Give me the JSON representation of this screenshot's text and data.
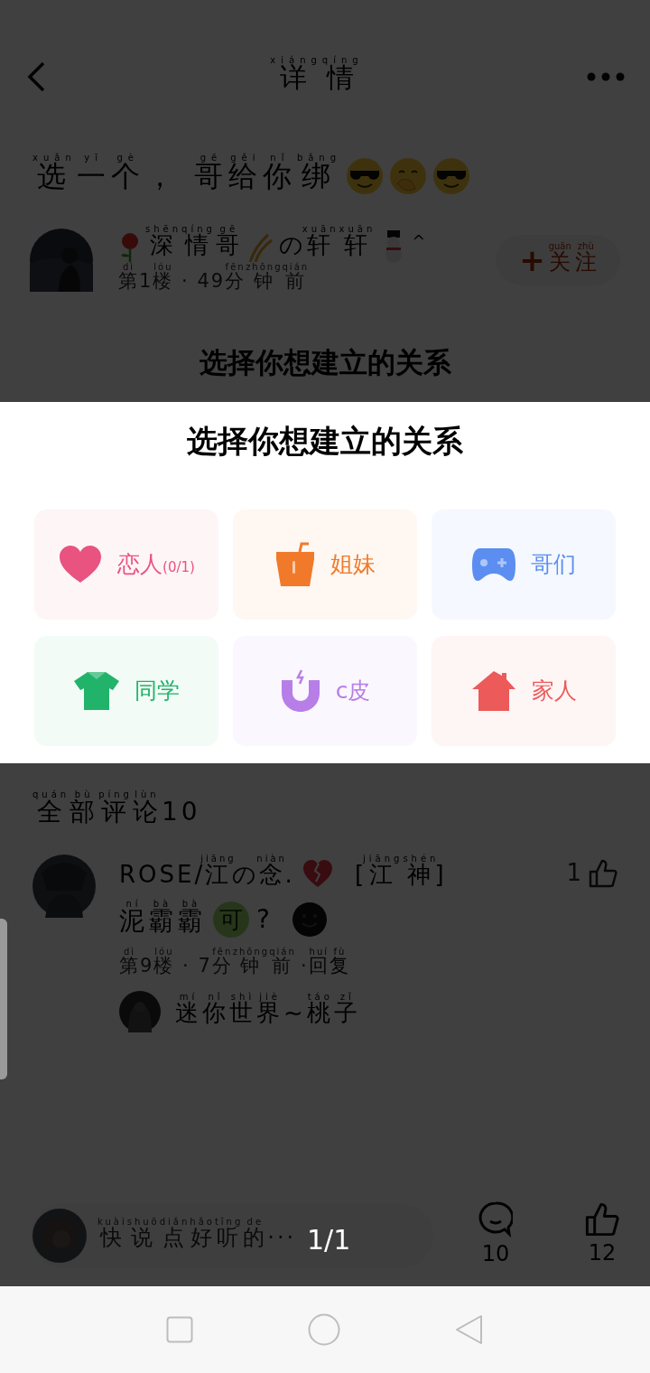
{
  "header": {
    "title": [
      {
        "t": "详",
        "py": "xiáng"
      },
      {
        "t": "情",
        "py": "qíng"
      }
    ]
  },
  "post": {
    "title": [
      {
        "t": "选",
        "py": "xuǎn"
      },
      {
        "t": "一",
        "py": "yī"
      },
      {
        "t": "个",
        "py": "gè"
      },
      {
        "t": "， "
      },
      {
        "t": "哥",
        "py": "gē"
      },
      {
        "t": "给",
        "py": "gěi"
      },
      {
        "t": "你",
        "py": "nǐ"
      },
      {
        "t": "绑",
        "py": "bǎng"
      }
    ],
    "author": {
      "name_parts": [
        [
          {
            "t": "深",
            "py": "shēn"
          },
          {
            "t": "情",
            "py": "qíng"
          },
          {
            "t": "哥",
            "py": "gē"
          }
        ],
        [
          {
            "t": "の"
          },
          {
            "t": "轩",
            "py": "xuān"
          },
          {
            "t": "轩",
            "py": "xuān"
          }
        ],
        [
          {
            "t": "^"
          }
        ]
      ],
      "meta": [
        {
          "t": "第",
          "py": "dì"
        },
        {
          "t": "1"
        },
        {
          "t": "楼",
          "py": "lóu"
        },
        {
          "t": " · 49"
        },
        {
          "t": "分",
          "py": "fēn"
        },
        {
          "t": "钟",
          "py": "zhōng"
        },
        {
          "t": "前",
          "py": "qián"
        }
      ],
      "follow": {
        "icon": "+",
        "label": [
          {
            "t": "关",
            "py": "guān"
          },
          {
            "t": "注",
            "py": "zhù"
          }
        ]
      }
    },
    "heading": "选择你想建立的关系"
  },
  "sheet": {
    "title": "选择你想建立的关系",
    "options": [
      {
        "label": "恋人",
        "count": "(0/1)",
        "color": "#e8547f"
      },
      {
        "label": "姐妹",
        "color": "#f07a2a"
      },
      {
        "label": "哥们",
        "color": "#5b8ef0"
      },
      {
        "label": "同学",
        "color": "#22b36a"
      },
      {
        "label": "c皮",
        "color": "#b77ee8"
      },
      {
        "label": "家人",
        "color": "#ec5a5a"
      }
    ]
  },
  "comments": {
    "heading": [
      {
        "t": "全",
        "py": "quán"
      },
      {
        "t": "部",
        "py": "bù"
      },
      {
        "t": "评",
        "py": "píng"
      },
      {
        "t": "论",
        "py": "lùn"
      },
      {
        "t": "10"
      }
    ],
    "items": [
      {
        "name": [
          {
            "t": "ROSE/"
          },
          {
            "t": "江",
            "py": "jiāng"
          },
          {
            "t": "の"
          },
          {
            "t": "念",
            "py": "niàn"
          },
          {
            "t": "."
          }
        ],
        "tag": [
          {
            "t": "["
          },
          {
            "t": "江",
            "py": "jiāng"
          },
          {
            "t": "神",
            "py": "shén"
          },
          {
            "t": "]"
          }
        ],
        "likes": "1",
        "text": [
          {
            "t": "泥",
            "py": "ní"
          },
          {
            "t": "霸",
            "py": "bà"
          },
          {
            "t": "霸",
            "py": "bà"
          }
        ],
        "badge": "可",
        "text_end": "?",
        "meta": [
          {
            "t": "第",
            "py": "dì"
          },
          {
            "t": "9"
          },
          {
            "t": "楼",
            "py": "lóu"
          },
          {
            "t": " · 7"
          },
          {
            "t": "分",
            "py": "fēn"
          },
          {
            "t": "钟",
            "py": "zhōng"
          },
          {
            "t": "前",
            "py": "qián"
          },
          {
            "t": " · "
          }
        ],
        "reply_link": [
          {
            "t": "回",
            "py": "huí"
          },
          {
            "t": "复",
            "py": "fù"
          }
        ],
        "reply": [
          {
            "t": "迷",
            "py": "mí"
          },
          {
            "t": "你",
            "py": "nǐ"
          },
          {
            "t": "世",
            "py": "shì"
          },
          {
            "t": "界",
            "py": "jiè"
          },
          {
            "t": "~"
          },
          {
            "t": "桃",
            "py": "táo"
          },
          {
            "t": "子",
            "py": "zǐ"
          }
        ]
      }
    ]
  },
  "bottom_bar": {
    "placeholder": [
      {
        "t": "快",
        "py": "kuài"
      },
      {
        "t": "说",
        "py": "shuō"
      },
      {
        "t": "点",
        "py": "diǎn"
      },
      {
        "t": "好",
        "py": "hǎo"
      },
      {
        "t": "听",
        "py": "tīng"
      },
      {
        "t": "的",
        "py": "de"
      },
      {
        "t": "···"
      }
    ],
    "comment_count": "10",
    "like_count": "12"
  },
  "page_indicator": "1/1"
}
